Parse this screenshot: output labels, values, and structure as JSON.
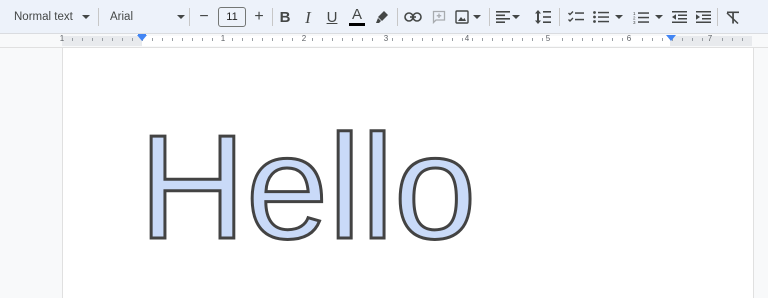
{
  "toolbar": {
    "style_label": "Normal text",
    "font_label": "Arial",
    "font_size": "11",
    "decrease_label": "−",
    "increase_label": "+",
    "bold_label": "B",
    "italic_label": "I",
    "underline_label": "U",
    "text_color_label": "A",
    "text_color": "#000000"
  },
  "ruler": {
    "numbers": [
      "1",
      "1",
      "2",
      "3",
      "4",
      "5",
      "6",
      "7"
    ]
  },
  "document": {
    "text": "Hello",
    "fill_color": "#c9daf8",
    "stroke_color": "#434343"
  }
}
